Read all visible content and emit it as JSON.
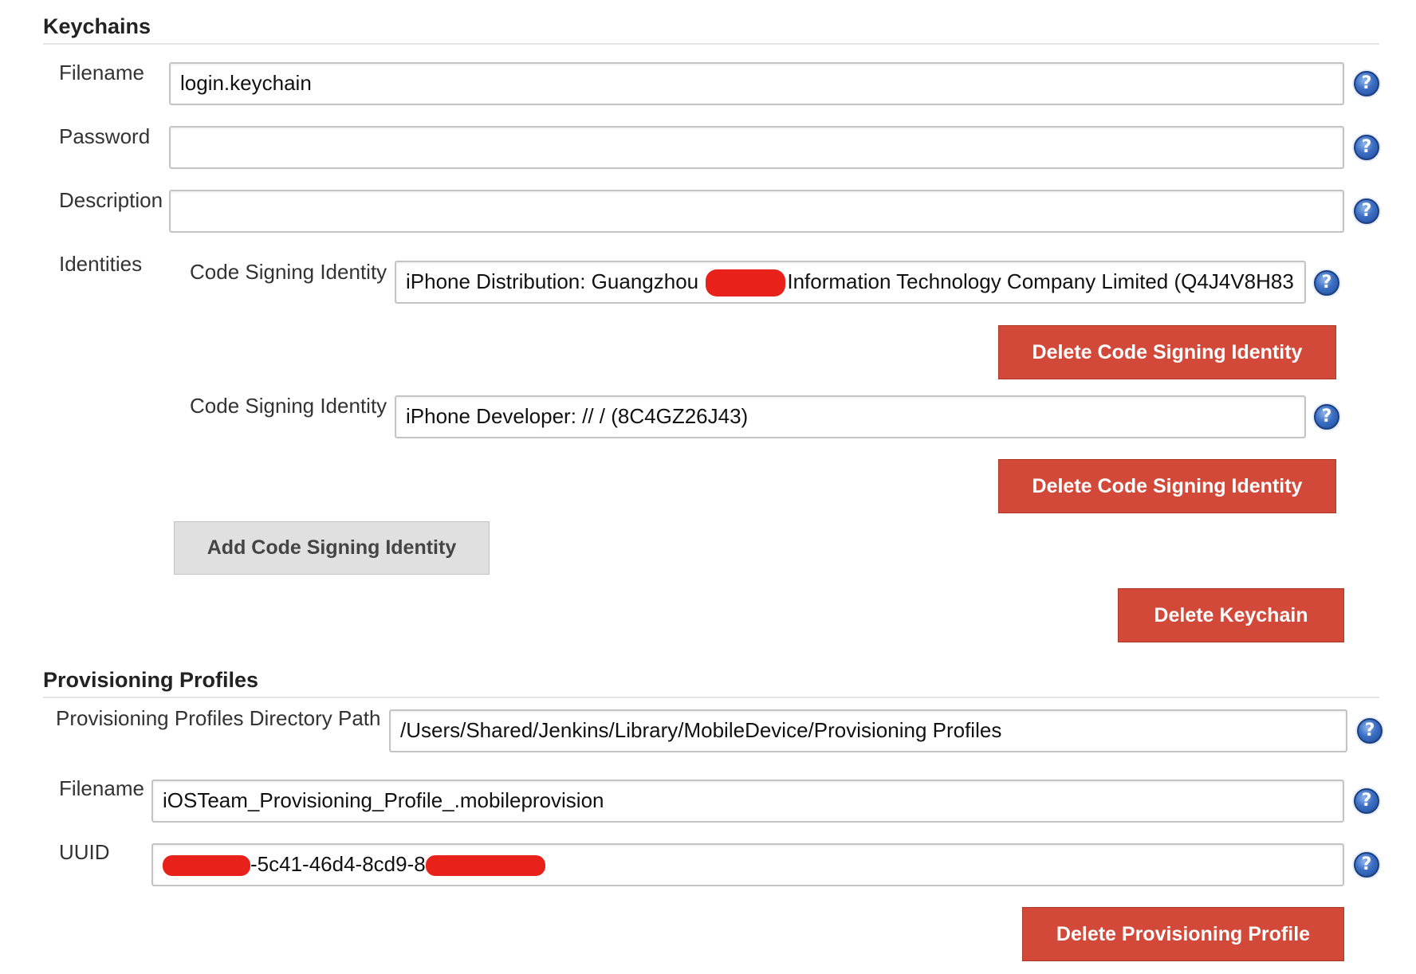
{
  "keychains": {
    "title": "Keychains",
    "filename_label": "Filename",
    "filename_value": "login.keychain",
    "password_label": "Password",
    "password_value": "",
    "description_label": "Description",
    "description_value": "",
    "identities_label": "Identities",
    "identities": [
      {
        "label": "Code Signing Identity",
        "value_prefix": "iPhone Distribution: Guangzhou ",
        "value_suffix": "Information Technology Company Limited (Q4J4V8H83",
        "delete_label": "Delete Code Signing Identity"
      },
      {
        "label": "Code Signing Identity",
        "value": "iPhone Developer: // / (8C4GZ26J43)",
        "delete_label": "Delete Code Signing Identity"
      }
    ],
    "add_identity_label": "Add Code Signing Identity",
    "delete_keychain_label": "Delete Keychain"
  },
  "provisioning": {
    "title": "Provisioning Profiles",
    "dir_label": "Provisioning Profiles Directory Path",
    "dir_value": "/Users/Shared/Jenkins/Library/MobileDevice/Provisioning Profiles",
    "filename_label": "Filename",
    "filename_value": "iOSTeam_Provisioning_Profile_.mobileprovision",
    "uuid_label": "UUID",
    "uuid_visible": "-5c41-46d4-8cd9-8",
    "delete_label": "Delete Provisioning Profile"
  },
  "help_glyph": "?",
  "colors": {
    "danger": "#d24939",
    "secondary": "#e0e0e0",
    "help": "#3c6fc4",
    "redaction": "#e8211b"
  }
}
